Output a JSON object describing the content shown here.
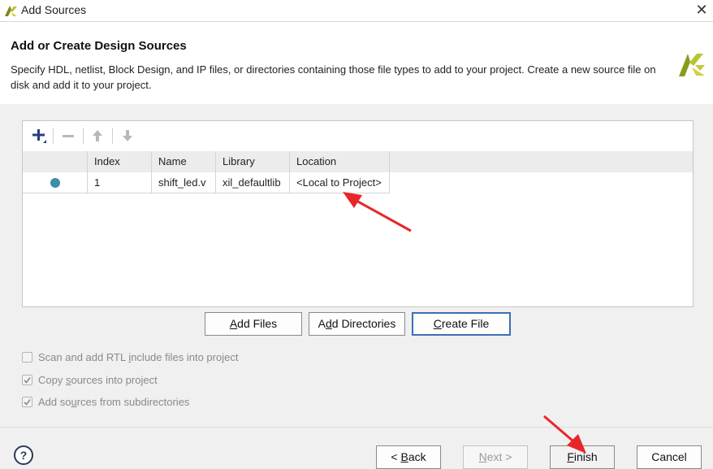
{
  "window": {
    "title": "Add Sources",
    "close_icon": "close-icon"
  },
  "header": {
    "title": "Add or Create Design Sources",
    "description": "Specify HDL, netlist, Block Design, and IP files, or directories containing those file types to add to your project. Create a new source file on disk and add it to your project."
  },
  "toolbar": {
    "icons": [
      "add-icon",
      "remove-icon",
      "move-up-icon",
      "move-down-icon"
    ]
  },
  "table": {
    "columns": [
      "",
      "Index",
      "Name",
      "Library",
      "Location"
    ],
    "rows": [
      {
        "status": "",
        "index": "1",
        "name": "shift_led.v",
        "library": "xil_defaultlib",
        "location": "<Local to Project>"
      }
    ]
  },
  "buttons": {
    "add_files": {
      "pre": "",
      "mn": "A",
      "post": "dd Files"
    },
    "add_directories": {
      "pre": "A",
      "mn": "d",
      "post": "d Directories"
    },
    "create_file": {
      "pre": "",
      "mn": "C",
      "post": "reate File"
    },
    "back": {
      "pre": "< ",
      "mn": "B",
      "post": "ack"
    },
    "next": {
      "pre": "",
      "mn": "N",
      "post": "ext >"
    },
    "finish": {
      "pre": "",
      "mn": "F",
      "post": "inish"
    },
    "cancel": {
      "pre": "",
      "mn": "",
      "post": "Cancel"
    }
  },
  "options": [
    {
      "pre": "Scan and add RTL ",
      "mn": "i",
      "post": "nclude files into project",
      "checked": false
    },
    {
      "pre": "Copy ",
      "mn": "s",
      "post": "ources into project",
      "checked": true
    },
    {
      "pre": "Add so",
      "mn": "u",
      "post": "rces from subdirectories",
      "checked": true
    }
  ],
  "help": {
    "label": "?"
  },
  "colors": {
    "accent": "#3a6fb7",
    "status_dot": "#3a8fa6",
    "annotation": "#e8262a"
  }
}
